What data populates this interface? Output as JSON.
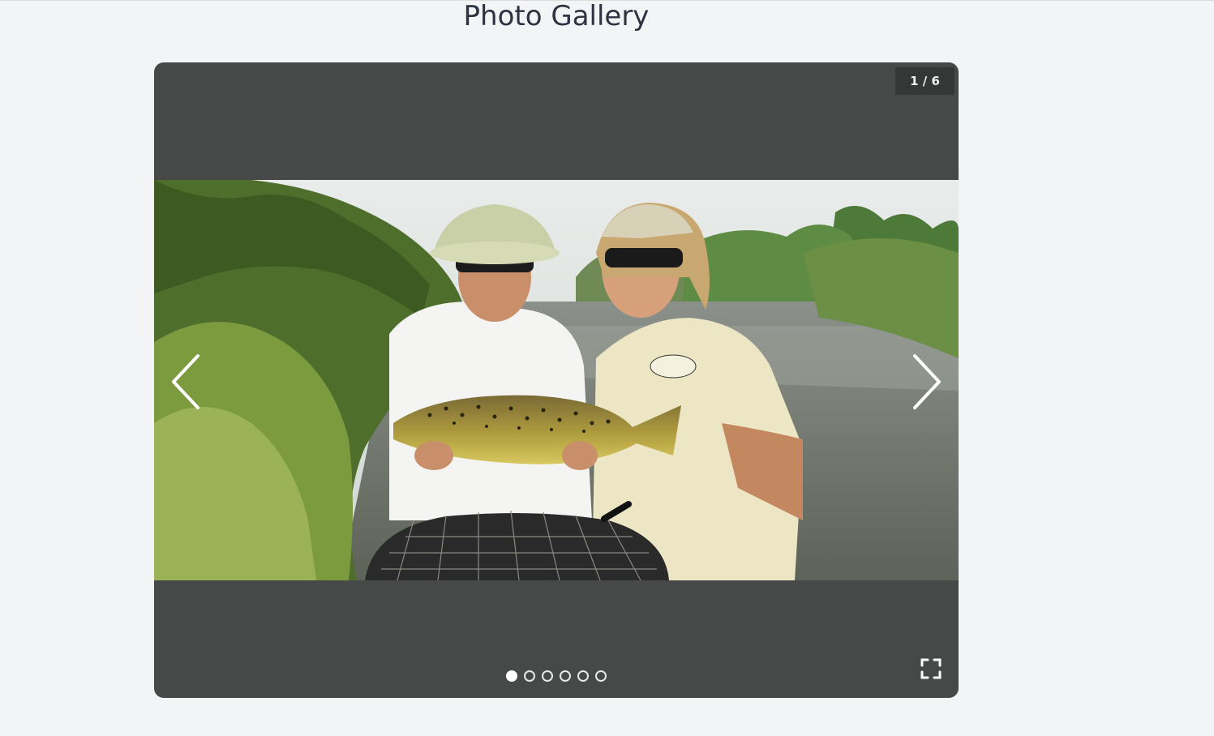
{
  "page": {
    "title": "Photo Gallery"
  },
  "gallery": {
    "counter": "1 / 6",
    "current_index": 1,
    "total": 6,
    "colors": {
      "frame": "#474848",
      "counter_bg": "#353636",
      "active_thumb_border": "#2a6fd0"
    },
    "slides": [
      {
        "icon": "photo-fishermen-trout"
      },
      {
        "icon": "photo-river-landscape"
      },
      {
        "icon": "photo-child-portrait"
      },
      {
        "icon": "photo-sunset"
      },
      {
        "icon": "photo-foggy-lake"
      },
      {
        "icon": "photo-blue-river"
      }
    ],
    "controls": {
      "prev_icon": "chevron-left-icon",
      "next_icon": "chevron-right-icon",
      "fullscreen_icon": "fullscreen-icon"
    }
  }
}
